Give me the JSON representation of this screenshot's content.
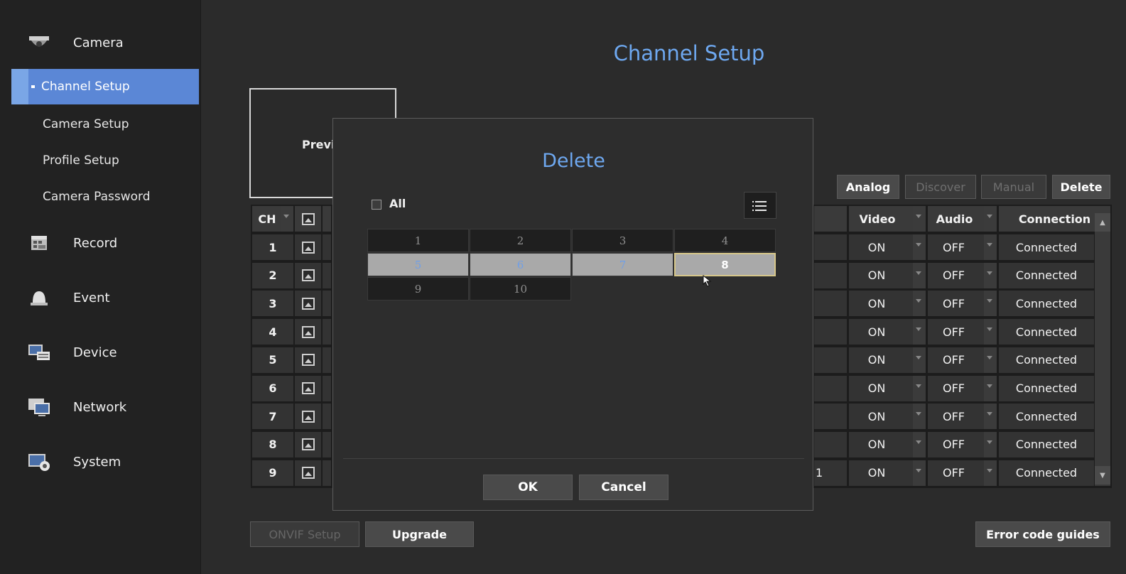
{
  "sidebar": {
    "sections": [
      {
        "label": "Camera",
        "icon": "camera-icon"
      },
      {
        "label": "Record",
        "icon": "record-icon"
      },
      {
        "label": "Event",
        "icon": "event-icon"
      },
      {
        "label": "Device",
        "icon": "device-icon"
      },
      {
        "label": "Network",
        "icon": "network-icon"
      },
      {
        "label": "System",
        "icon": "system-icon"
      }
    ],
    "camera_items": [
      {
        "label": "Channel Setup",
        "active": true
      },
      {
        "label": "Camera Setup",
        "active": false
      },
      {
        "label": "Profile Setup",
        "active": false
      },
      {
        "label": "Camera Password",
        "active": false
      }
    ]
  },
  "page": {
    "title": "Channel Setup",
    "preview_label": "Previ"
  },
  "toolbar": {
    "analog": "Analog",
    "discover": "Discover",
    "manual": "Manual",
    "delete": "Delete"
  },
  "table": {
    "headers": {
      "ch": "CH",
      "video": "Video",
      "audio": "Audio",
      "connection": "Connection"
    },
    "partial_cell_row9": "1",
    "rows": [
      {
        "ch": "1",
        "video": "ON",
        "audio": "OFF",
        "connection": "Connected"
      },
      {
        "ch": "2",
        "video": "ON",
        "audio": "OFF",
        "connection": "Connected"
      },
      {
        "ch": "3",
        "video": "ON",
        "audio": "OFF",
        "connection": "Connected"
      },
      {
        "ch": "4",
        "video": "ON",
        "audio": "OFF",
        "connection": "Connected"
      },
      {
        "ch": "5",
        "video": "ON",
        "audio": "OFF",
        "connection": "Connected"
      },
      {
        "ch": "6",
        "video": "ON",
        "audio": "OFF",
        "connection": "Connected"
      },
      {
        "ch": "7",
        "video": "ON",
        "audio": "OFF",
        "connection": "Connected"
      },
      {
        "ch": "8",
        "video": "ON",
        "audio": "OFF",
        "connection": "Connected"
      },
      {
        "ch": "9",
        "video": "ON",
        "audio": "OFF",
        "connection": "Connected"
      }
    ]
  },
  "bottom": {
    "onvif": "ONVIF Setup",
    "upgrade": "Upgrade",
    "error_guides": "Error code guides"
  },
  "modal": {
    "title": "Delete",
    "all_label": "All",
    "channels": [
      {
        "label": "1",
        "state": "normal"
      },
      {
        "label": "2",
        "state": "normal"
      },
      {
        "label": "3",
        "state": "normal"
      },
      {
        "label": "4",
        "state": "normal"
      },
      {
        "label": "5",
        "state": "selected"
      },
      {
        "label": "6",
        "state": "selected"
      },
      {
        "label": "7",
        "state": "selected"
      },
      {
        "label": "8",
        "state": "hover"
      },
      {
        "label": "9",
        "state": "normal"
      },
      {
        "label": "10",
        "state": "normal"
      }
    ],
    "ok": "OK",
    "cancel": "Cancel"
  },
  "colors": {
    "accent": "#6ea8f0",
    "active_nav": "#5b87d6"
  }
}
